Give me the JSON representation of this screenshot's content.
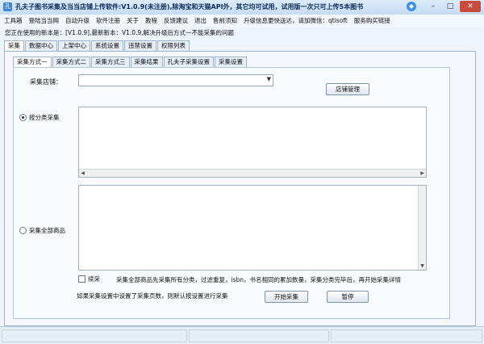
{
  "window": {
    "title": "孔夫子图书采集及当当店铺上传软件:V1.0.9(未注册),除淘宝和天猫API外，其它均可试用，试用版一次只可上传5本图书",
    "minimize": "–",
    "maximize": "□",
    "close": "✕",
    "shield": "◆"
  },
  "menu": [
    "工具箱",
    "登陆当当网",
    "自动升级",
    "软件注册",
    "关于",
    "教程",
    "反馈建议",
    "退出",
    "售前须知",
    "升级信息更快送达，请加微信：qtisoft",
    "服务购买链接"
  ],
  "version_line": "您正在使用的新本是：[V1.0.9],最新新本：V1.0.9,解决升级后方式一不能采集的问题",
  "main_tabs": [
    "采集",
    "数据中心",
    "上架中心",
    "系统设置",
    "违禁设置",
    "权限列表"
  ],
  "sub_tabs": [
    "采集方式一",
    "采集方式二",
    "采集方式三",
    "采集结果",
    "孔夫子采集设置",
    "采集设置"
  ],
  "form": {
    "store_label": "采集店铺：",
    "store_value": "",
    "store_manage_button": "店铺管理",
    "radio_category": "按分类采集",
    "radio_all": "采集全部商品",
    "resume_label": "续采",
    "note_all": "采集全部商品先采集所有分类，过滤重复，isbn，书名相同的累加数量，采集分类完毕后，再开始采集详情",
    "note_pages": "如果采集设置中设置了采集页数，则默认按设置进行采集",
    "start_button": "开始采集",
    "pause_button": "暂停"
  },
  "state": {
    "selected_radio": "category",
    "resume_checked": false
  }
}
